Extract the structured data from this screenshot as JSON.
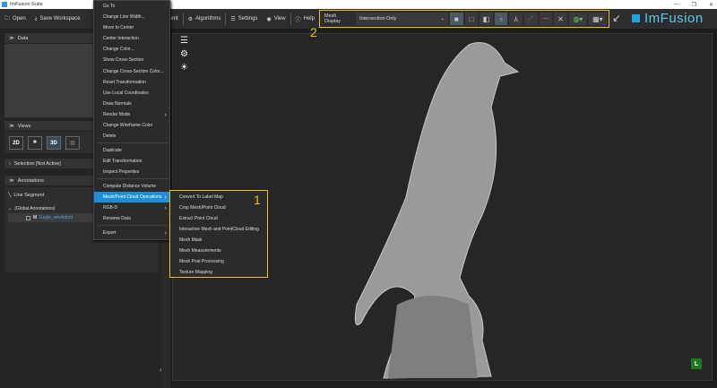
{
  "window": {
    "title": "ImFusion Suite",
    "controls": [
      "—",
      "❐",
      "✕"
    ]
  },
  "toolbar": {
    "open": "Open",
    "save_workspace": "Save Workspace",
    "recent": "Recent",
    "algorithms": "Algorithms",
    "settings": "Settings",
    "view": "View",
    "help": "Help"
  },
  "mesh_display": {
    "label": "Mesh Display",
    "value": "Intersection Only"
  },
  "brand": "ImFusion",
  "left_panel": {
    "data": "Data",
    "views": "Views",
    "view_buttons": [
      "2D",
      "3D"
    ],
    "selection": "Selection [Not Active]",
    "annotations": "Annotations",
    "line_segment": "Line Segment",
    "global_annotations": "(Global Annotations)",
    "item": "Eagle_wholebird",
    "item_type": "M",
    "collapse": "«"
  },
  "context_menu": {
    "items": [
      "Go To",
      "Change Line Width...",
      "Move to Center",
      "Center Interaction",
      "Change Color...",
      "Show Cross-Section",
      "Change Cross-Section Color...",
      "Reset Transformation",
      "Use Local Coordinates",
      "Draw Normals",
      "Render Mode",
      "Change Wireframe Color",
      "Delete",
      "Duplicate",
      "Edit Transformation",
      "Inspect Properties",
      "Compute Distance Volume",
      "Mesh/Point Cloud Operations",
      "RGB-D",
      "Rename Data",
      "Export"
    ]
  },
  "submenu": {
    "items": [
      "Convert To Label Map",
      "Crop Mesh/Point Cloud",
      "Extract Point Cloud",
      "Interactive Mesh and PointCloud Editing",
      "Mesh Mask",
      "Mesh Measurements",
      "Mesh Post Processing",
      "Texture Mapping"
    ]
  },
  "annotations_callouts": {
    "one": "1",
    "two": "2"
  },
  "viewport": {
    "orientation_badge": "L"
  },
  "colors": {
    "highlight": "#1e8fd6",
    "callout": "#e8c21a",
    "brand": "#1fa3e0"
  }
}
